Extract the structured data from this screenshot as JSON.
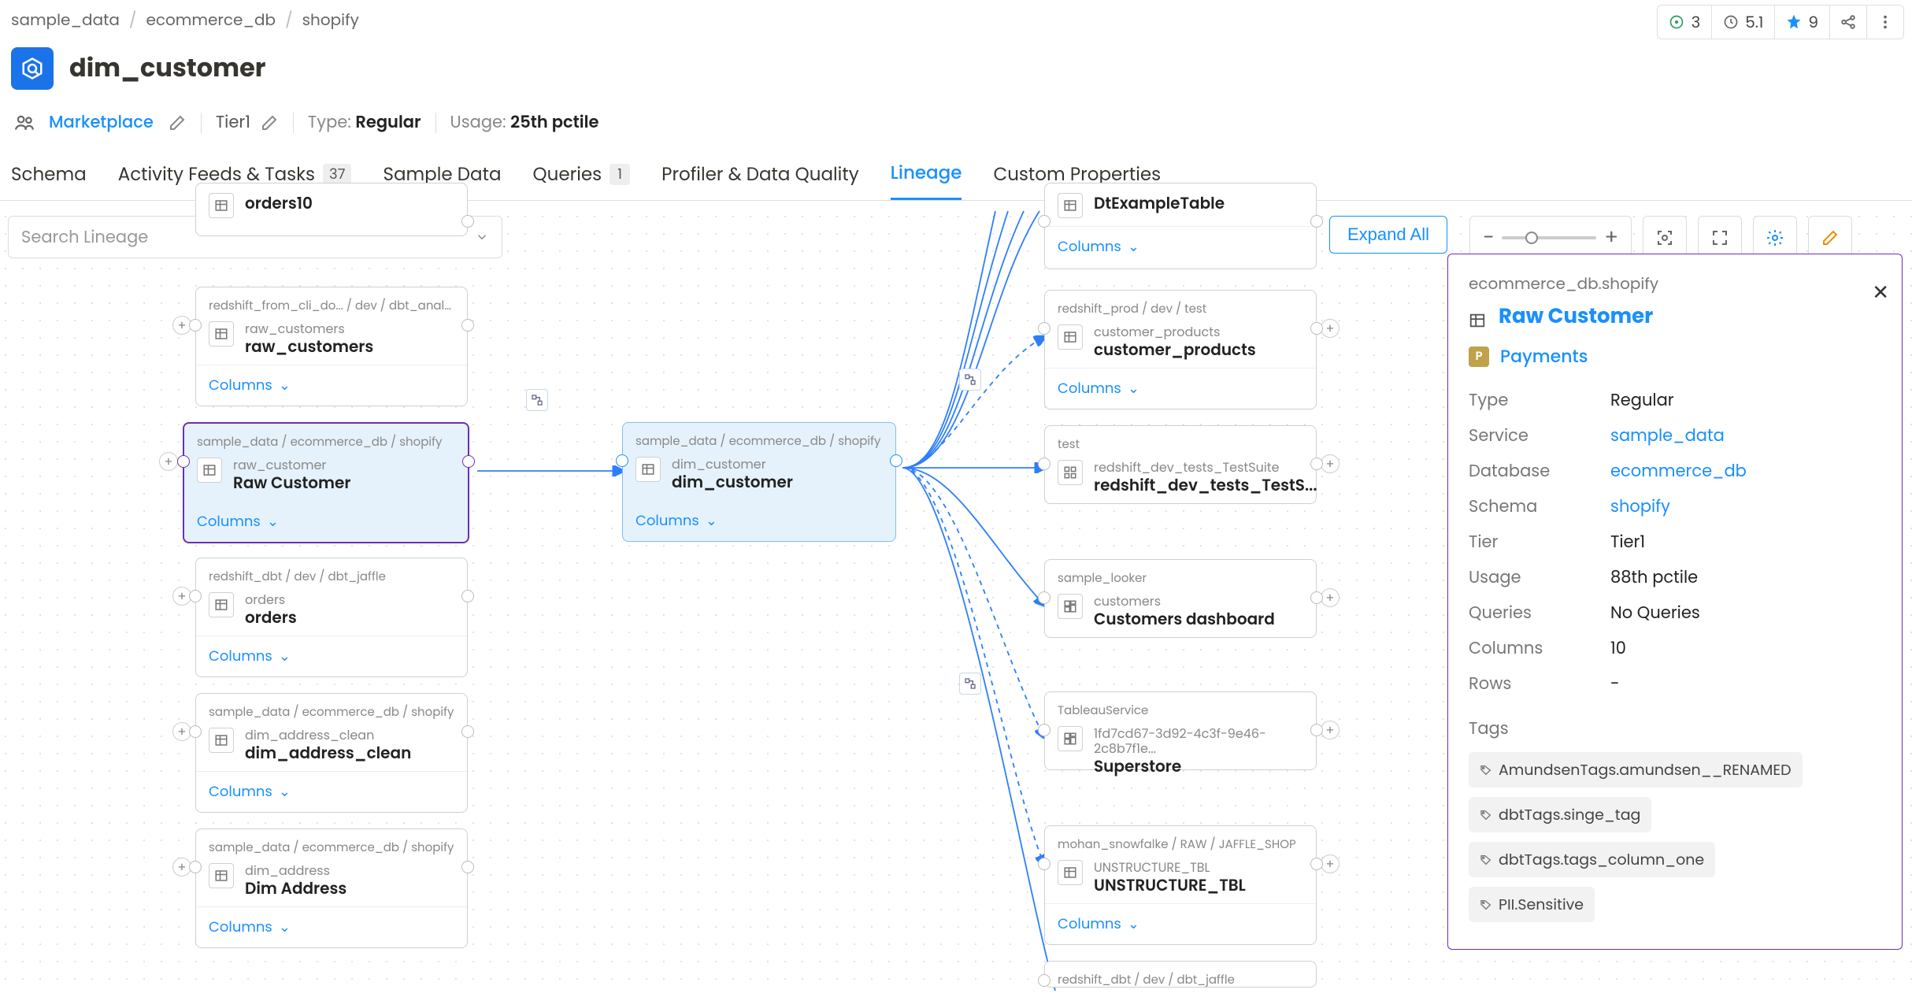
{
  "breadcrumb": [
    "sample_data",
    "ecommerce_db",
    "shopify"
  ],
  "stats": {
    "conversations": "3",
    "time": "5.1",
    "stars": "9"
  },
  "title": "dim_customer",
  "meta": {
    "marketplace": "Marketplace",
    "tier": "Tier1",
    "type_label": "Type:",
    "type_value": "Regular",
    "usage_label": "Usage:",
    "usage_value": "25th pctile"
  },
  "tabs": [
    {
      "label": "Schema"
    },
    {
      "label": "Activity Feeds & Tasks",
      "badge": "37"
    },
    {
      "label": "Sample Data"
    },
    {
      "label": "Queries",
      "badge": "1"
    },
    {
      "label": "Profiler & Data Quality"
    },
    {
      "label": "Lineage",
      "active": true
    },
    {
      "label": "Custom Properties"
    }
  ],
  "search_placeholder": "Search Lineage",
  "expand_all": "Expand All",
  "columns_label": "Columns",
  "nodes": {
    "orders10": {
      "path": "",
      "sub": "",
      "name": "orders10"
    },
    "rawc": {
      "path": "redshift_from_cli_do... / dev / dbt_analysis",
      "sub": "raw_customers",
      "name": "raw_customers"
    },
    "rcust": {
      "path": "sample_data / ecommerce_db / shopify",
      "sub": "raw_customer",
      "name": "Raw Customer"
    },
    "orders": {
      "path": "redshift_dbt / dev / dbt_jaffle",
      "sub": "orders",
      "name": "orders"
    },
    "dac": {
      "path": "sample_data / ecommerce_db / shopify",
      "sub": "dim_address_clean",
      "name": "dim_address_clean"
    },
    "da": {
      "path": "sample_data / ecommerce_db / shopify",
      "sub": "dim_address",
      "name": "Dim Address"
    },
    "center": {
      "path": "sample_data / ecommerce_db / shopify",
      "sub": "dim_customer",
      "name": "dim_customer"
    },
    "dtex": {
      "path": "",
      "sub": "",
      "name": "DtExampleTable"
    },
    "cprod": {
      "path": "redshift_prod / dev / test",
      "sub": "customer_products",
      "name": "customer_products"
    },
    "rtest": {
      "path": "test",
      "sub": "redshift_dev_tests_TestSuite",
      "name": "redshift_dev_tests_TestS..."
    },
    "cdash": {
      "path": "sample_looker",
      "sub": "customers",
      "name": "Customers dashboard"
    },
    "tbl": {
      "path": "TableauService",
      "sub": "1fd7cd67-3d92-4c3f-9e46-2c8b7f1e...",
      "name": "Superstore"
    },
    "unst": {
      "path": "mohan_snowfalke / RAW / JAFFLE_SHOP",
      "sub": "UNSTRUCTURE_TBL",
      "name": "UNSTRUCTURE_TBL"
    },
    "jaf": {
      "path": "redshift_dbt / dev / dbt_jaffle",
      "sub": "",
      "name": ""
    }
  },
  "panel": {
    "path": "ecommerce_db.shopify",
    "title": "Raw Customer",
    "domain": "Payments",
    "kv": [
      {
        "k": "Type",
        "v": "Regular"
      },
      {
        "k": "Service",
        "v": "sample_data",
        "link": true
      },
      {
        "k": "Database",
        "v": "ecommerce_db",
        "link": true
      },
      {
        "k": "Schema",
        "v": "shopify",
        "link": true
      },
      {
        "k": "Tier",
        "v": "Tier1"
      },
      {
        "k": "Usage",
        "v": "88th pctile"
      },
      {
        "k": "Queries",
        "v": "No Queries"
      },
      {
        "k": "Columns",
        "v": "10"
      },
      {
        "k": "Rows",
        "v": "-"
      }
    ],
    "tags_label": "Tags",
    "tags": [
      "AmundsenTags.amundsen__RENAMED",
      "dbtTags.singe_tag",
      "dbtTags.tags_column_one",
      "PII.Sensitive"
    ]
  }
}
